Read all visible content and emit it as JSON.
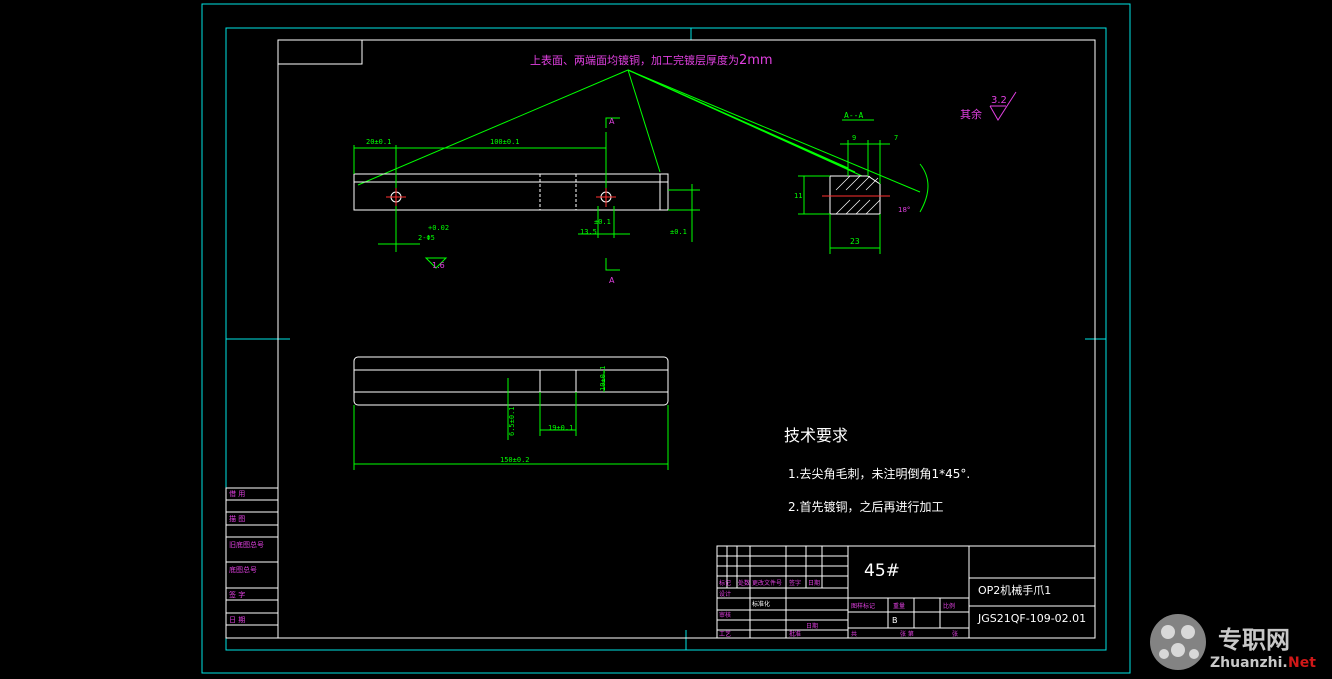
{
  "annotation": {
    "callout": "上表面、两端面均镀铜，加工完镀层厚度为",
    "callout_value": "2mm",
    "roughness_label": "其余",
    "roughness_value": "3.2"
  },
  "front_view": {
    "dim_left": "20±0.1",
    "dim_mid": "100±0.1",
    "hole_spec": "2-Φ5",
    "hole_tol": "+0.02",
    "dim_small": "13.5",
    "tol_small": "±0.1",
    "tol_side": "±0.1",
    "rough": "1.6",
    "section_mark": "A"
  },
  "section_view": {
    "title": "A--A",
    "dim_9": "9",
    "dim_7": "7",
    "dim_23": "23",
    "dim_11": "11",
    "angle": "18°"
  },
  "top_view": {
    "dim_depth": "6.5±0.1",
    "dim_slot": "19±0.1",
    "dim_total": "150±0.2",
    "dim_height": "10±0.1"
  },
  "tech": {
    "title": "技术要求",
    "item1": "1.去尖角毛刺，未注明倒角1*45°.",
    "item2": "2.首先镀铜，之后再进行加工"
  },
  "title_block": {
    "material": "45#",
    "part_name": "OP2机械手爪1",
    "drawing_no": "JGS21QF-109-02.01",
    "sheet_label": "B",
    "row_labels": [
      "标记",
      "处数",
      "更改文件号",
      "签字",
      "日期"
    ],
    "left_labels": [
      "设计",
      "审核",
      "工艺"
    ],
    "sign_label": "标准化",
    "approve": "批准",
    "stage": "图样标记",
    "weight": "重量",
    "scale": "比例",
    "sheet": "共",
    "sheets": "张 第",
    "page": "张",
    "date": "日期"
  },
  "side_strip": [
    "借 用",
    "描 图",
    "旧底图总号",
    "底图总号",
    "签 字",
    "日 期"
  ],
  "watermark": {
    "cn": "专职网",
    "url": "Zhuanzhi.",
    "url2": "Net"
  },
  "colors": {
    "frame": "#ffffff",
    "border": "#00e5e5",
    "dims": "#00ff00",
    "text": "#e040e0",
    "hidden": "#d0d0d0"
  }
}
